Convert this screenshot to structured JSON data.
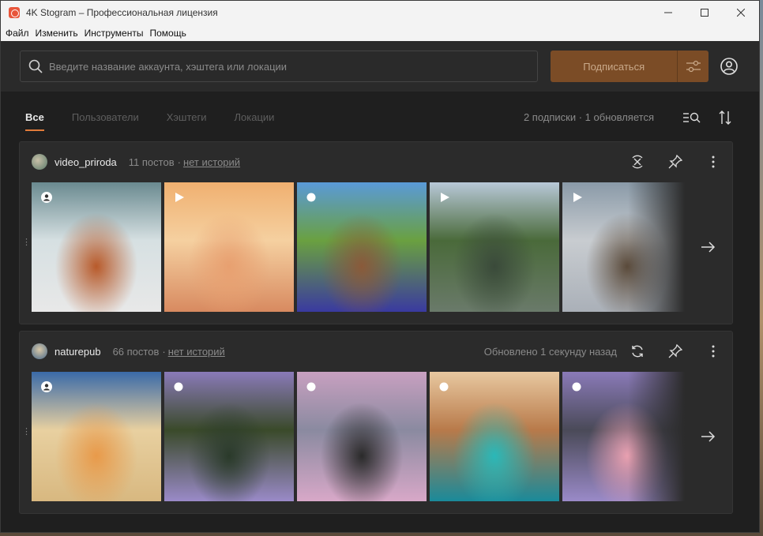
{
  "window": {
    "title": "4K Stogram – Профессиональная лицензия"
  },
  "menu": [
    "Файл",
    "Изменить",
    "Инструменты",
    "Помощь"
  ],
  "search": {
    "placeholder": "Введите название аккаунта, хэштега или локации"
  },
  "subscribe_label": "Подписаться",
  "tabs": [
    "Все",
    "Пользователи",
    "Хэштеги",
    "Локации"
  ],
  "status": "2 подписки · 1 обновляется",
  "accounts": [
    {
      "name": "video_priroda",
      "posts": "11 постов",
      "separator": "·",
      "stories": "нет историй",
      "updated": "",
      "thumbs": [
        {
          "badge": "user-icon",
          "colors": [
            "#6a8a90",
            "#d6e0e2",
            "#b85a2a",
            "#e8e8e8"
          ]
        },
        {
          "badge": "play-icon",
          "colors": [
            "#f0b070",
            "#f5d0a0",
            "#e8a070",
            "#d88a60"
          ]
        },
        {
          "badge": "dot-icon",
          "colors": [
            "#5a9ad8",
            "#6aa040",
            "#8a5a3a",
            "#3a3aa0"
          ]
        },
        {
          "badge": "play-icon",
          "colors": [
            "#b8c8d8",
            "#4a6a3a",
            "#3a4a3a",
            "#6a7a6a"
          ]
        },
        {
          "badge": "play-icon",
          "colors": [
            "#8a9aa8",
            "#c8ccd0",
            "#5a4a3a",
            "#aab0b8"
          ]
        }
      ]
    },
    {
      "name": "naturepub",
      "posts": "66 постов",
      "separator": "·",
      "stories": "нет историй",
      "updated": "Обновлено 1 секунду назад",
      "thumbs": [
        {
          "badge": "user-icon",
          "colors": [
            "#3a6aa8",
            "#e8d0a0",
            "#e89a4a",
            "#d8b880"
          ]
        },
        {
          "badge": "dot-icon",
          "colors": [
            "#8a7ab8",
            "#3a4a2a",
            "#2a3a2a",
            "#9a8ac8"
          ]
        },
        {
          "badge": "dot-icon",
          "colors": [
            "#c8a0c0",
            "#8a8aa0",
            "#2a2a2a",
            "#d8a8c8"
          ]
        },
        {
          "badge": "dot-icon",
          "colors": [
            "#e8c8a0",
            "#b87a4a",
            "#2ab8b8",
            "#1a8a9a"
          ]
        },
        {
          "badge": "dot-icon",
          "colors": [
            "#8a7ab8",
            "#4a4a58",
            "#e8a0b0",
            "#9a8ac8"
          ]
        }
      ]
    }
  ],
  "colors": {
    "accent": "#e07b3a",
    "subscribe_bg": "#7b4c26",
    "panel": "#2b2b2b",
    "bg": "#1f1f1f"
  }
}
